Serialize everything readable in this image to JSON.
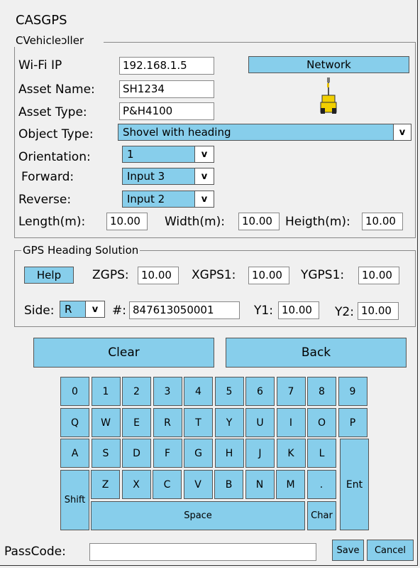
{
  "app": {
    "title": "CASGPS"
  },
  "vehicle_group": {
    "legend": "CVehicleɔller",
    "wifi_label": "Wi-Fi IP",
    "wifi_value": "192.168.1.5",
    "network_button": "Network",
    "asset_name_label": "Asset Name:",
    "asset_name_value": "SH1234",
    "asset_type_label": "Asset Type:",
    "asset_type_value": "P&H4100",
    "object_type_label": "Object Type:",
    "object_type_value": "Shovel with heading",
    "orientation_label": "Orientation:",
    "orientation_value": "1",
    "forward_label": "Forward:",
    "forward_value": "Input 3",
    "reverse_label": "Reverse:",
    "reverse_value": "Input 2",
    "length_label": "Length(m):",
    "length_value": "10.00",
    "width_label": "Width(m):",
    "width_value": "10.00",
    "height_label": "Heigth(m):",
    "height_value": "10.00",
    "caret": "v"
  },
  "gps_group": {
    "legend": "GPS Heading Solution",
    "help_button": "Help",
    "zgps_label": "ZGPS:",
    "zgps_value": "10.00",
    "xgps1_label": "XGPS1:",
    "xgps1_value": "10.00",
    "ygps1_label": "YGPS1:",
    "ygps1_value": "10.00",
    "side_label": "Side:",
    "side_value": "R",
    "serial_label": "#:",
    "serial_value": "847613050001",
    "y1_label": "Y1:",
    "y1_value": "10.00",
    "y2_label": "Y2:",
    "y2_value": "10.00"
  },
  "keypad": {
    "clear": "Clear",
    "back": "Back",
    "row1": [
      "0",
      "1",
      "2",
      "3",
      "4",
      "5",
      "6",
      "7",
      "8",
      "9"
    ],
    "row2": [
      "Q",
      "W",
      "E",
      "R",
      "T",
      "Y",
      "U",
      "I",
      "O",
      "P"
    ],
    "row3": [
      "A",
      "S",
      "D",
      "F",
      "G",
      "H",
      "J",
      "K",
      "L"
    ],
    "row4": [
      "Z",
      "X",
      "C",
      "V",
      "B",
      "N",
      "M",
      "."
    ],
    "shift": "Shift",
    "space": "Space",
    "char": "Char",
    "enter": "Ent"
  },
  "footer": {
    "passcode_label": "PassCode:",
    "passcode_value": "",
    "save": "Save",
    "cancel": "Cancel"
  }
}
